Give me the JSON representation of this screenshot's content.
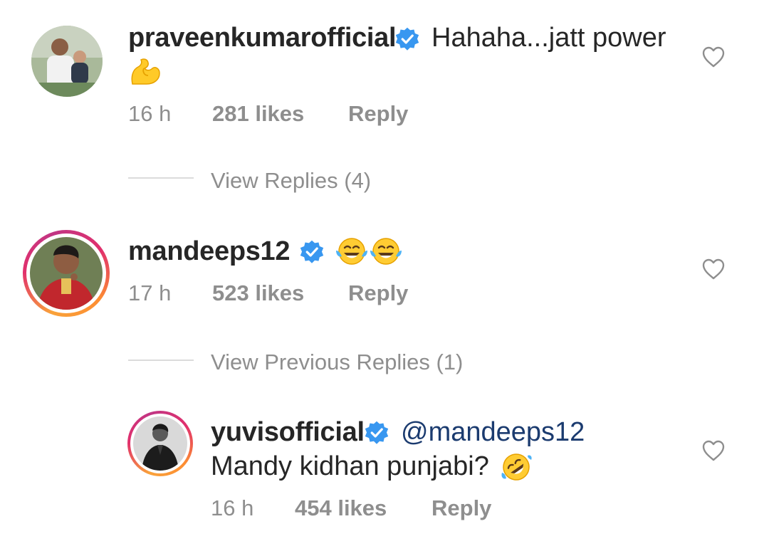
{
  "comments": [
    {
      "username": "praveenkumarofficial",
      "text_line1": "Hahaha...jatt power",
      "emoji": "flexed-biceps",
      "time": "16 h",
      "likes": "281 likes",
      "reply": "Reply",
      "view_replies": "View Replies (4)"
    },
    {
      "username": "mandeeps12",
      "emoji": "face-with-tears-of-joy x2",
      "time": "17 h",
      "likes": "523 likes",
      "reply": "Reply",
      "view_replies": "View Previous Replies (1)"
    },
    {
      "username": "yuvisofficial",
      "mention": "@mandeeps12",
      "text_line2": "Mandy kidhan punjabi?",
      "emoji": "rolling-on-the-floor-laughing",
      "time": "16 h",
      "likes": "454 likes",
      "reply": "Reply"
    }
  ],
  "colors": {
    "text": "#262626",
    "meta": "#8e8e8e",
    "verified": "#3897f0",
    "mention": "#1b3b6f"
  }
}
